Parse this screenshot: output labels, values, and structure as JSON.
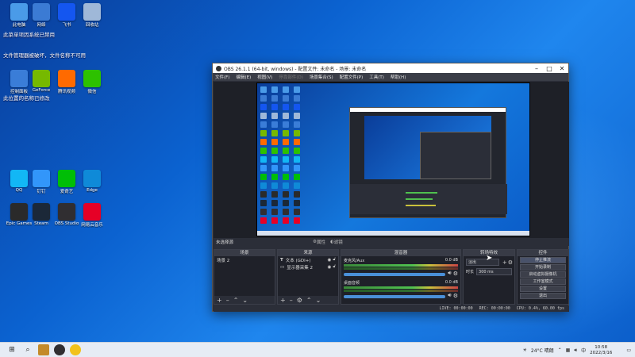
{
  "colors": {
    "accent": "#0b62d0",
    "obs_bg": "#2b2e38",
    "dock_bg": "#1f2129"
  },
  "desktop": {
    "icons": [
      {
        "label": "此电脑",
        "icon": "computer-icon",
        "color": "#4a9be8"
      },
      {
        "label": "网络",
        "icon": "network-icon",
        "color": "#3b7bd4"
      },
      {
        "label": "飞书",
        "icon": "feishu-icon",
        "color": "#1456f0"
      },
      {
        "label": "回收站",
        "icon": "recycle-bin-icon",
        "color": "#9fb8d8"
      },
      {
        "label": "控制面板",
        "icon": "control-panel-icon",
        "color": "#3a7dd8"
      },
      {
        "label": "GeForce",
        "icon": "nvidia-icon",
        "color": "#76b900"
      },
      {
        "label": "腾讯视频",
        "icon": "tencent-video-icon",
        "color": "#ff6a00"
      },
      {
        "label": "微信",
        "icon": "wechat-icon",
        "color": "#2dc100"
      },
      {
        "label": "QQ",
        "icon": "qq-icon",
        "color": "#12b7f5"
      },
      {
        "label": "钉钉",
        "icon": "dingtalk-icon",
        "color": "#3296fa"
      },
      {
        "label": "爱奇艺",
        "icon": "iqiyi-icon",
        "color": "#00be06"
      },
      {
        "label": "Edge",
        "icon": "edge-icon",
        "color": "#0f8ad8"
      },
      {
        "label": "Epic Games",
        "icon": "epic-icon",
        "color": "#2a2a2a"
      },
      {
        "label": "Steam",
        "icon": "steam-icon",
        "color": "#1b2838"
      },
      {
        "label": "OBS Studio",
        "icon": "obs-icon",
        "color": "#302e31"
      },
      {
        "label": "网易云音乐",
        "icon": "netease-music-icon",
        "color": "#e60026"
      }
    ],
    "notices": [
      "此菜单项因系统已禁用",
      "文件管理器被破坏，文件名称不可用",
      "此位置的名称已修改"
    ]
  },
  "obs": {
    "title": "OBS 26.1.1 (64-bit, windows) - 配置文件: 未命名 - 场景: 未命名",
    "menu": [
      "文件(F)",
      "编辑(E)",
      "视图(V)",
      "停靠部件(D)",
      "场景集合(S)",
      "配置文件(P)",
      "工具(T)",
      "帮助(H)"
    ],
    "controls_bar": {
      "name": "未选择源",
      "properties": "属性",
      "filters": "滤镜"
    },
    "docks": {
      "scenes": {
        "title": "场景",
        "items": [
          "场景 2"
        ]
      },
      "sources": {
        "title": "来源",
        "items": [
          "文本 (GDI+)",
          "显示器采集 2"
        ]
      },
      "mixer": {
        "title": "混音器",
        "channels": [
          {
            "name": "麦克风/Aux",
            "db": "0.0 dB"
          },
          {
            "name": "桌面音频",
            "db": "0.0 dB"
          }
        ]
      },
      "transitions": {
        "title": "转场特效",
        "type": "淡出",
        "duration_label": "时长",
        "duration": "300 ms"
      },
      "controls": {
        "title": "控件",
        "buttons": [
          "停止推流",
          "开始录制",
          "启动虚拟摄像机",
          "工作室模式",
          "设置",
          "退出"
        ]
      }
    },
    "status": {
      "live": "LIVE: 00:00:00",
      "rec": "REC: 00:00:00",
      "cpu": "CPU: 0.4%, 60.00 fps"
    }
  },
  "taskbar": {
    "weather": "24°C 晴朗",
    "time": "10:58",
    "date": "2022/3/16",
    "lang": "中"
  }
}
